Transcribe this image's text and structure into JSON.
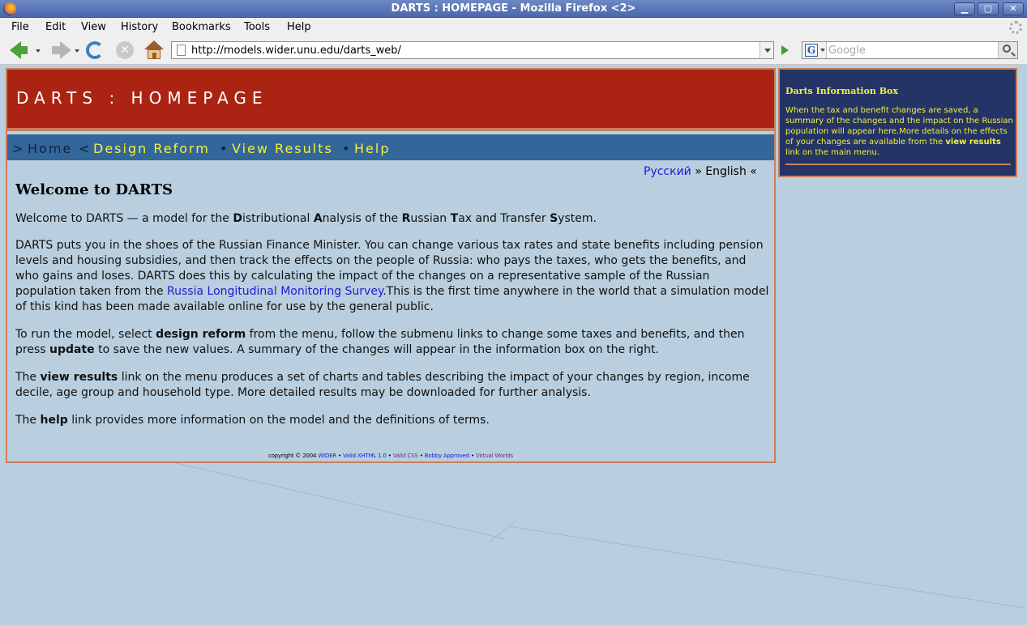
{
  "window": {
    "title": "DARTS : HOMEPAGE - Mozilla Firefox <2>",
    "minimize": "▁",
    "maximize": "▢",
    "close": "✕"
  },
  "menu": [
    "File",
    "Edit",
    "View",
    "History",
    "Bookmarks",
    "Tools",
    "Help"
  ],
  "toolbar": {
    "url": "http://models.wider.unu.edu/darts_web/",
    "search_placeholder": "Google",
    "search_engine": "G"
  },
  "page": {
    "banner_title": "DARTS : HOMEPAGE",
    "nav": {
      "current_prefix": ">",
      "home": "Home",
      "current_suffix": "<",
      "dot": "•",
      "design_reform": "Design Reform",
      "view_results": "View Results",
      "help": "Help"
    },
    "lang": {
      "russian": "Русский",
      "sep": "»",
      "english": "English",
      "end": "«"
    },
    "title": "Welcome to DARTS",
    "p1": {
      "a": "Welcome to DARTS — a model for the ",
      "d": "D",
      "d_rest": "istributional ",
      "an": "A",
      "an_rest": "nalysis of the ",
      "r": "R",
      "r_rest": "ussian ",
      "t": "T",
      "t_rest": "ax and Transfer ",
      "s": "S",
      "s_rest": "ystem."
    },
    "p2": {
      "text": "DARTS puts you in the shoes of the Russian Finance Minister. You can change various tax rates and state benefits including pension levels and housing subsidies, and then track the effects on the people of Russia: who pays the taxes, who gets the benefits, and who gains and loses. DARTS does this by calculating the impact of the changes on a representative sample of the Russian population taken from the ",
      "link": "Russia Longitudinal Monitoring Survey",
      "after": ".This is the first time anywhere in the world that a simulation model of this kind has been made available online for use by the general public."
    },
    "p3": {
      "a": "To run the model, select ",
      "b1": "design reform",
      "c": " from the menu, follow the submenu links to change some taxes and benefits, and then press ",
      "b2": "update",
      "d": " to save the new values. A summary of the changes will appear in the information box on the right."
    },
    "p4": {
      "a": "The ",
      "b": "view results",
      "c": " link on the menu produces a set of charts and tables describing the impact of your changes by region, income decile, age group and household type. More detailed results may be downloaded for further analysis."
    },
    "p5": {
      "a": "The ",
      "b": "help",
      "c": " link provides more information on the model and the definitions of terms."
    },
    "footer": {
      "copyright": "copyright © 2004",
      "wider": "WIDER",
      "dot": "•",
      "xhtml": "Valid XHTML 1.0",
      "css": "Valid CSS",
      "bobby": "Bobby Approved",
      "vw": "Virtual Worlds"
    }
  },
  "info_box": {
    "title": "Darts Information Box",
    "text_a": "When the tax and benefit changes are saved, a summary of the changes and the impact on the Russian population will appear here.More details on the effects of your changes are available from the ",
    "text_b": "view results",
    "text_c": " link on the main menu."
  },
  "colors": {
    "banner": "#ab2313",
    "nav": "#336699",
    "nav_link": "#f4f03c",
    "page_bg": "#b9cfdf",
    "info_bg": "#243466",
    "border": "#c7805b"
  }
}
